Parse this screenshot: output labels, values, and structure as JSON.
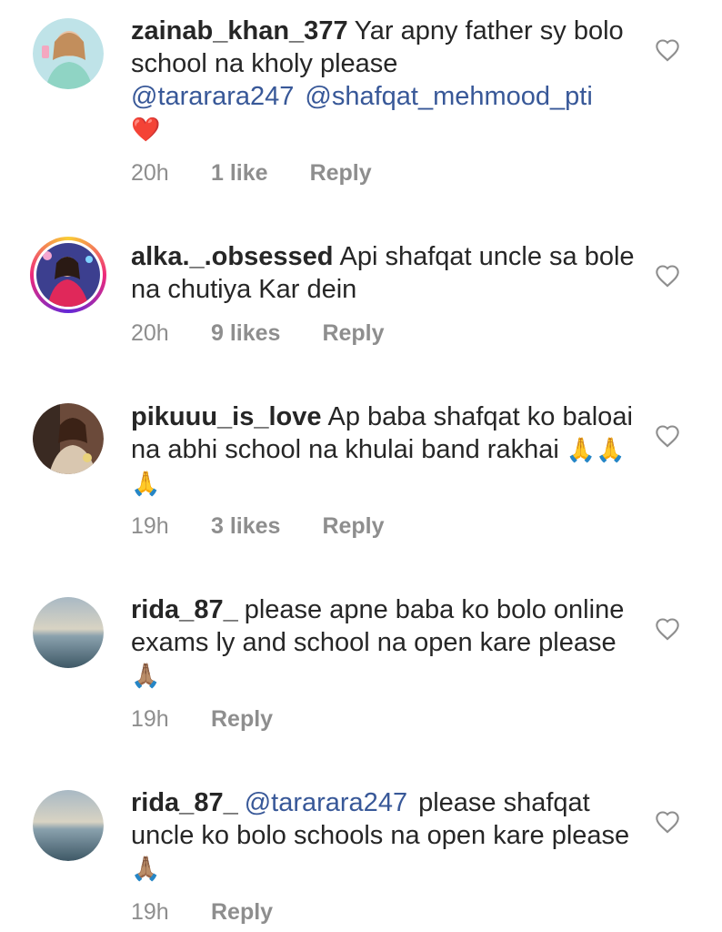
{
  "comments": [
    {
      "username": "zainab_khan_377",
      "text": "Yar apny father sy bolo school na kholy please",
      "mentions": [
        "@tararara247",
        "@shafqat_mehmood_pti"
      ],
      "emoji": "❤️",
      "time": "20h",
      "likes": "1 like",
      "reply": "Reply"
    },
    {
      "username": "alka._.obsessed",
      "text": "Api shafqat uncle sa bole na chutiya Kar dein",
      "time": "20h",
      "likes": "9 likes",
      "reply": "Reply"
    },
    {
      "username": "pikuuu_is_love",
      "text": "Ap baba shafqat ko baloai na abhi school na khulai band rakhai",
      "emoji": "🙏🙏🙏",
      "time": "19h",
      "likes": "3 likes",
      "reply": "Reply"
    },
    {
      "username": "rida_87_",
      "text": "please apne baba ko bolo online exams ly and school na open kare please",
      "emoji": "🙏🏽",
      "time": "19h",
      "reply": "Reply"
    },
    {
      "username": "rida_87_",
      "mention": "@tararara247",
      "text": "please shafqat uncle ko bolo schools na open kare please",
      "emoji": "🙏🏽",
      "time": "19h",
      "reply": "Reply"
    }
  ],
  "colors": {
    "text": "#262626",
    "meta": "#8e8e8e",
    "mention": "#385898",
    "heart_red": "#e0245e"
  },
  "icons": {
    "like": "heart-outline-icon"
  }
}
